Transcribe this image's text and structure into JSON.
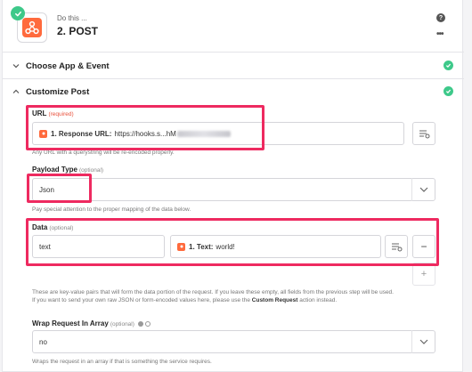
{
  "step": {
    "subtitle": "Do this ...",
    "title": "2. POST",
    "help": "?",
    "more": "•••"
  },
  "sections": {
    "choose_app": "Choose App & Event",
    "customize": "Customize Post"
  },
  "url_field": {
    "label": "URL",
    "required": "(required)",
    "pill_label": "1. Response URL:",
    "pill_value": "https://hooks.s...hM",
    "help": "Any URL with a querystring will be re-encoded properly."
  },
  "payload_field": {
    "label": "Payload Type",
    "optional": "(optional)",
    "value": "Json",
    "help": "Pay special attention to the proper mapping of the data below."
  },
  "data_field": {
    "label": "Data",
    "optional": "(optional)",
    "key": "text",
    "pill_label": "1. Text:",
    "pill_value": "world!",
    "remove": "−",
    "add": "+",
    "help_line1": "These are key-value pairs that will form the data portion of the request. If you leave these empty, all fields from the previous step will be used.",
    "help_line2_a": "If you want to send your own raw JSON or form-encoded values here, please use the",
    "help_line2_b": "Custom Request",
    "help_line2_c": "action instead."
  },
  "wrap_field": {
    "label": "Wrap Request In Array",
    "optional": "(optional)",
    "value": "no",
    "help": "Wraps the request in an array if that is something the service requires."
  },
  "colors": {
    "accent_highlight": "#ee2a60",
    "success": "#3ec98a",
    "brand_orange": "#ff6a3d"
  }
}
